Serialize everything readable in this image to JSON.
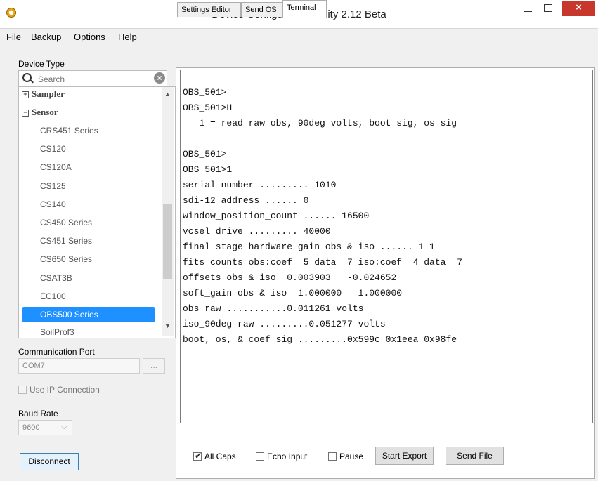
{
  "window": {
    "title": "Device Configuration Utility 2.12 Beta",
    "close_glyph": "×"
  },
  "menu": [
    "File",
    "Backup",
    "Options",
    "Help"
  ],
  "sidebar": {
    "device_type_label": "Device Type",
    "search_placeholder": "Search",
    "groups": [
      {
        "label": "Sampler",
        "expander": "+"
      },
      {
        "label": "Sensor",
        "expander": "−"
      }
    ],
    "devices": [
      "CRS451 Series",
      "CS120",
      "CS120A",
      "CS125",
      "CS140",
      "CS450 Series",
      "CS451 Series",
      "CS650 Series",
      "CSAT3B",
      "EC100",
      "OBS500 Series",
      "SoilProf3"
    ],
    "selected_device": "OBS500 Series",
    "comm_port_label": "Communication Port",
    "comm_port_value": "COM7",
    "browse_label": "...",
    "use_ip_label": "Use IP Connection",
    "baud_rate_label": "Baud Rate",
    "baud_rate_value": "9600",
    "disconnect_label": "Disconnect"
  },
  "tabs": [
    "Settings Editor",
    "Send OS",
    "Terminal"
  ],
  "active_tab": "Terminal",
  "terminal": {
    "lines": [
      "OBS_501>",
      "OBS_501>H",
      "   1 = read raw obs, 90deg volts, boot sig, os sig",
      "",
      "OBS_501>",
      "OBS_501>1",
      "serial number ......... 1010",
      "sdi-12 address ...... 0",
      "window_position_count ...... 16500",
      "vcsel drive ......... 40000",
      "final stage hardware gain obs & iso ...... 1 1",
      "fits counts obs:coef= 5 data= 7 iso:coef= 4 data= 7",
      "offsets obs & iso  0.003903   -0.024652",
      "soft_gain obs & iso  1.000000   1.000000",
      "obs raw ...........0.011261 volts",
      "iso_90deg raw .........0.051277 volts",
      "boot, os, & coef sig .........0x599c 0x1eea 0x98fe"
    ]
  },
  "bottom": {
    "all_caps": {
      "label": "All Caps",
      "checked": true
    },
    "echo_input": {
      "label": "Echo Input",
      "checked": false
    },
    "pause": {
      "label": "Pause",
      "checked": false
    },
    "start_export_label": "Start Export",
    "send_file_label": "Send File"
  }
}
